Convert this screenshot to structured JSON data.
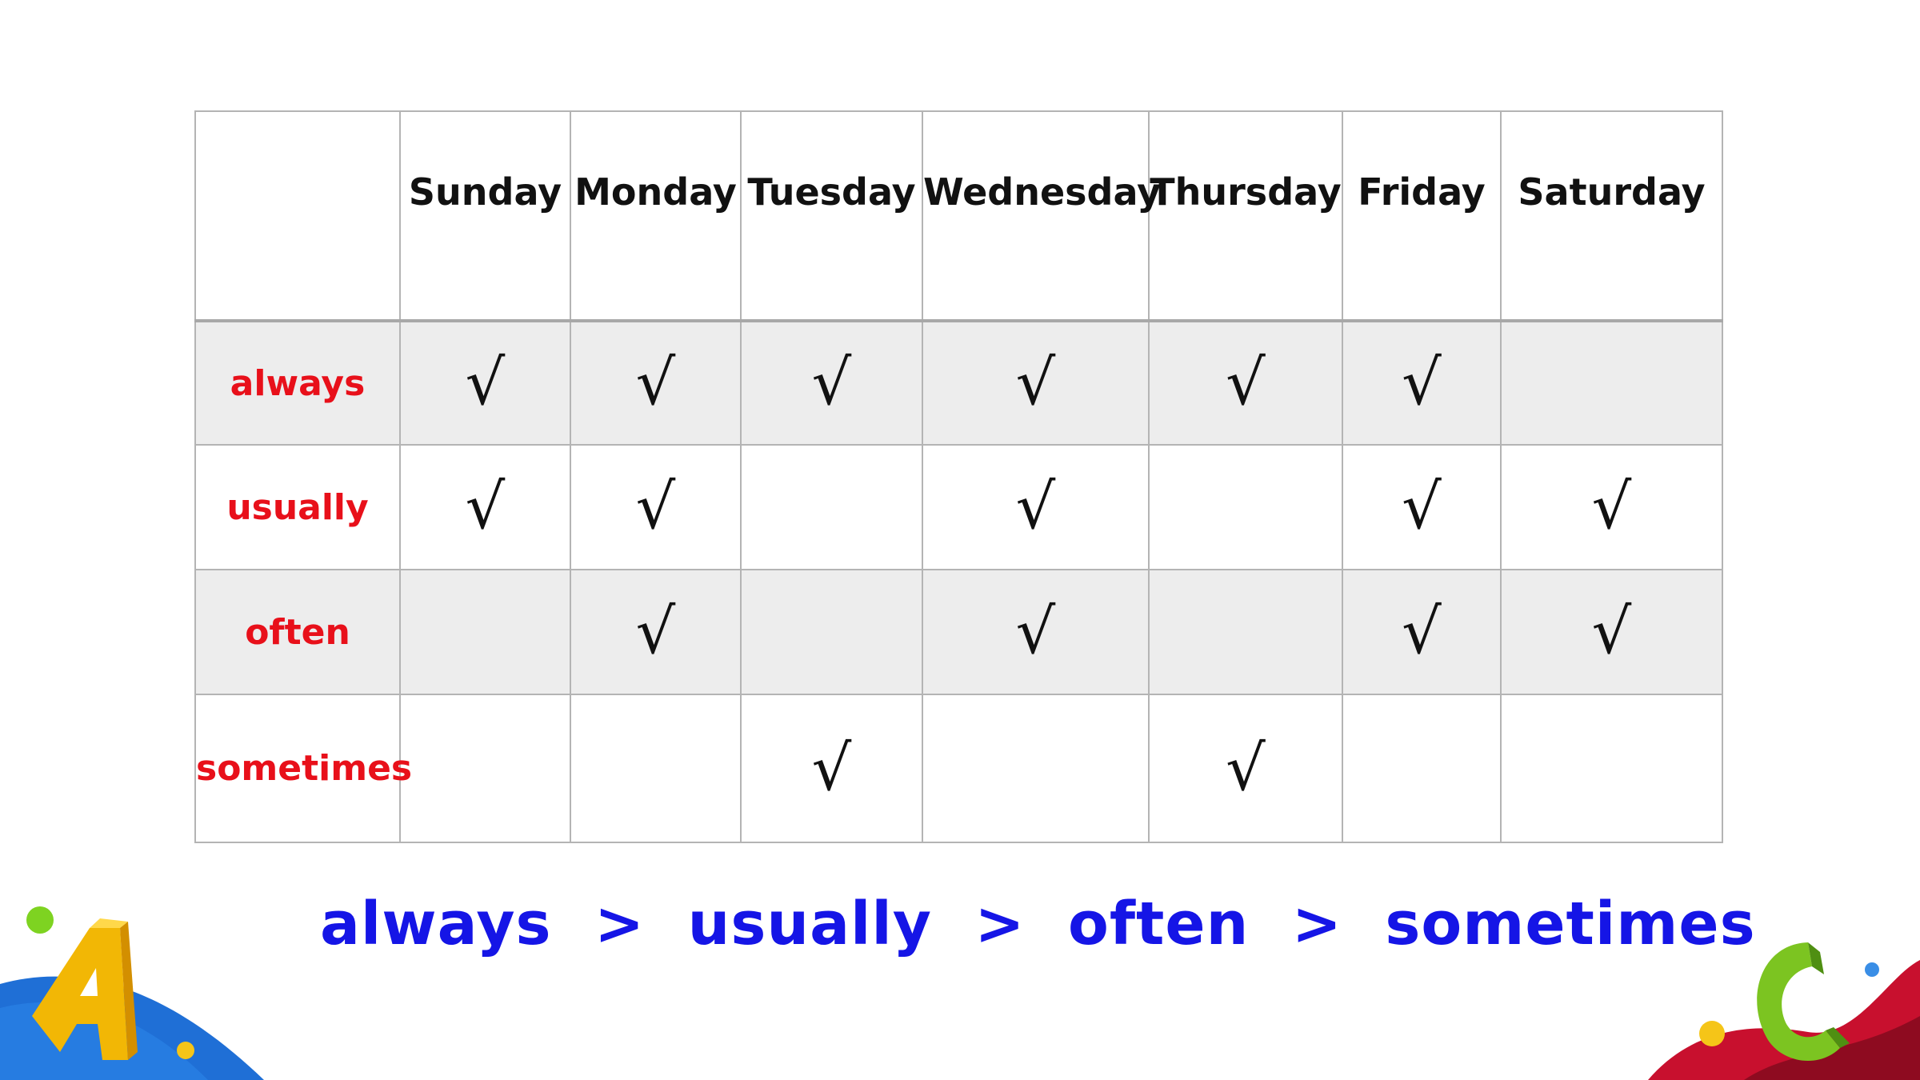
{
  "table": {
    "days": [
      "Sunday",
      "Monday",
      "Tuesday",
      "Wednesday",
      "Thursday",
      "Friday",
      "Saturday"
    ],
    "rows": [
      {
        "label": "always",
        "cells": [
          "√",
          "√",
          "√",
          "√",
          "√",
          "√",
          ""
        ]
      },
      {
        "label": "usually",
        "cells": [
          "√",
          "√",
          "",
          "√",
          "",
          "√",
          "√"
        ]
      },
      {
        "label": "often",
        "cells": [
          "",
          "√",
          "",
          "√",
          "",
          "√",
          "√"
        ]
      },
      {
        "label": "sometimes",
        "cells": [
          "",
          "",
          "√",
          "",
          "√",
          "",
          ""
        ]
      }
    ]
  },
  "summary": "always  >  usually  >  often  >  sometimes",
  "colors": {
    "frequency_label": "#e8101a",
    "summary_text": "#1515e6",
    "shaded_row": "#ededed",
    "grid_line": "#b4b4b4"
  },
  "icons": {
    "bottom_left": "yellow-letter-a-icon",
    "bottom_right": "green-letter-c-icon"
  }
}
